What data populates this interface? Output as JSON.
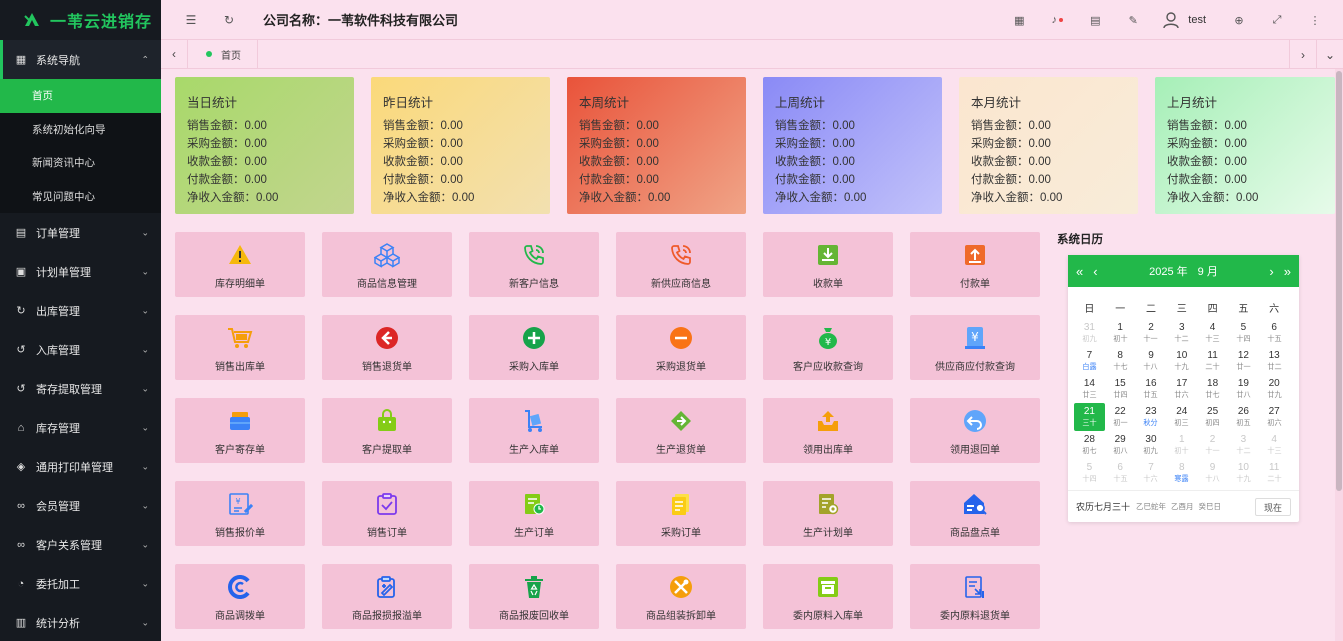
{
  "app": {
    "name": "一苇云进销存"
  },
  "header": {
    "company_label": "公司名称：",
    "company_name": "一苇软件科技有限公司",
    "user": "test"
  },
  "sidebar": {
    "groups": [
      {
        "label": "系统导航",
        "icon": "nav-grid-icon",
        "open": true
      },
      {
        "label": "订单管理",
        "icon": "document-icon"
      },
      {
        "label": "计划单管理",
        "icon": "calendar-icon"
      },
      {
        "label": "出库管理",
        "icon": "outbound-icon"
      },
      {
        "label": "入库管理",
        "icon": "inbound-icon"
      },
      {
        "label": "寄存提取管理",
        "icon": "deposit-icon"
      },
      {
        "label": "库存管理",
        "icon": "home-icon"
      },
      {
        "label": "通用打印单管理",
        "icon": "cube-icon"
      },
      {
        "label": "会员管理",
        "icon": "link-icon"
      },
      {
        "label": "客户关系管理",
        "icon": "link-icon"
      },
      {
        "label": "委托加工",
        "icon": "pie-icon"
      },
      {
        "label": "统计分析",
        "icon": "chart-icon"
      }
    ],
    "sub_items": [
      {
        "label": "首页",
        "active": true
      },
      {
        "label": "系统初始化向导"
      },
      {
        "label": "新闻资讯中心"
      },
      {
        "label": "常见问题中心"
      }
    ]
  },
  "tabs": [
    {
      "label": "首页"
    }
  ],
  "stats": [
    {
      "title": "当日统计",
      "rows": [
        "销售金额：0.00",
        "采购金额：0.00",
        "收款金额：0.00",
        "付款金额：0.00",
        "净收入金额：0.00"
      ]
    },
    {
      "title": "昨日统计",
      "rows": [
        "销售金额：0.00",
        "采购金额：0.00",
        "收款金额：0.00",
        "付款金额：0.00",
        "净收入金额：0.00"
      ]
    },
    {
      "title": "本周统计",
      "rows": [
        "销售金额：0.00",
        "采购金额：0.00",
        "收款金额：0.00",
        "付款金额：0.00",
        "净收入金额：0.00"
      ]
    },
    {
      "title": "上周统计",
      "rows": [
        "销售金额：0.00",
        "采购金额：0.00",
        "收款金额：0.00",
        "付款金额：0.00",
        "净收入金额：0.00"
      ]
    },
    {
      "title": "本月统计",
      "rows": [
        "销售金额：0.00",
        "采购金额：0.00",
        "收款金额：0.00",
        "付款金额：0.00",
        "净收入金额：0.00"
      ]
    },
    {
      "title": "上月统计",
      "rows": [
        "销售金额：0.00",
        "采购金额：0.00",
        "收款金额：0.00",
        "付款金额：0.00",
        "净收入金额：0.00"
      ]
    }
  ],
  "tiles": [
    {
      "label": "库存明细单",
      "icon": "warning-icon"
    },
    {
      "label": "商品信息管理",
      "icon": "cubes-icon"
    },
    {
      "label": "新客户信息",
      "icon": "phone-icon"
    },
    {
      "label": "新供应商信息",
      "icon": "phone-icon"
    },
    {
      "label": "收款单",
      "icon": "download-box-icon"
    },
    {
      "label": "付款单",
      "icon": "upload-box-icon"
    },
    {
      "label": "销售出库单",
      "icon": "cart-icon"
    },
    {
      "label": "销售退货单",
      "icon": "arrow-left-circle-icon"
    },
    {
      "label": "采购入库单",
      "icon": "plus-circle-icon"
    },
    {
      "label": "采购退货单",
      "icon": "minus-circle-icon"
    },
    {
      "label": "客户应收款查询",
      "icon": "money-bag-icon"
    },
    {
      "label": "供应商应付款查询",
      "icon": "yen-bill-icon"
    },
    {
      "label": "客户寄存单",
      "icon": "wallet-icon"
    },
    {
      "label": "客户提取单",
      "icon": "bag-icon"
    },
    {
      "label": "生产入库单",
      "icon": "trolley-icon"
    },
    {
      "label": "生产退货单",
      "icon": "return-tag-icon"
    },
    {
      "label": "领用出库单",
      "icon": "tray-icon"
    },
    {
      "label": "领用退回单",
      "icon": "undo-circle-icon"
    },
    {
      "label": "销售报价单",
      "icon": "quote-doc-icon"
    },
    {
      "label": "销售订单",
      "icon": "clipboard-check-icon"
    },
    {
      "label": "生产订单",
      "icon": "doc-clock-icon"
    },
    {
      "label": "采购订单",
      "icon": "doc-stack-icon"
    },
    {
      "label": "生产计划单",
      "icon": "doc-gear-icon"
    },
    {
      "label": "商品盘点单",
      "icon": "home-search-icon"
    },
    {
      "label": "商品调拨单",
      "icon": "transfer-circle-icon"
    },
    {
      "label": "商品报损报溢单",
      "icon": "clipboard-edit-icon"
    },
    {
      "label": "商品报废回收单",
      "icon": "recycle-bin-icon"
    },
    {
      "label": "商品组装拆卸单",
      "icon": "tools-icon"
    },
    {
      "label": "委内原料入库单",
      "icon": "inbox-box-icon"
    },
    {
      "label": "委内原料退货单",
      "icon": "doc-return-icon"
    }
  ],
  "calendar": {
    "title": "系统日历",
    "year_label": "2025 年",
    "month_label": "9 月",
    "weekdays": [
      "日",
      "一",
      "二",
      "三",
      "四",
      "五",
      "六"
    ],
    "days": [
      {
        "n": "31",
        "l": "初九",
        "dim": true
      },
      {
        "n": "1",
        "l": "初十"
      },
      {
        "n": "2",
        "l": "十一"
      },
      {
        "n": "3",
        "l": "十二"
      },
      {
        "n": "4",
        "l": "十三"
      },
      {
        "n": "5",
        "l": "十四"
      },
      {
        "n": "6",
        "l": "十五"
      },
      {
        "n": "7",
        "l": "白露",
        "blue": true
      },
      {
        "n": "8",
        "l": "十七"
      },
      {
        "n": "9",
        "l": "十八"
      },
      {
        "n": "10",
        "l": "十九"
      },
      {
        "n": "11",
        "l": "二十"
      },
      {
        "n": "12",
        "l": "廿一"
      },
      {
        "n": "13",
        "l": "廿二"
      },
      {
        "n": "14",
        "l": "廿三"
      },
      {
        "n": "15",
        "l": "廿四"
      },
      {
        "n": "16",
        "l": "廿五"
      },
      {
        "n": "17",
        "l": "廿六"
      },
      {
        "n": "18",
        "l": "廿七"
      },
      {
        "n": "19",
        "l": "廿八"
      },
      {
        "n": "20",
        "l": "廿九"
      },
      {
        "n": "21",
        "l": "三十",
        "today": true
      },
      {
        "n": "22",
        "l": "初一"
      },
      {
        "n": "23",
        "l": "秋分",
        "blue": true
      },
      {
        "n": "24",
        "l": "初三"
      },
      {
        "n": "25",
        "l": "初四"
      },
      {
        "n": "26",
        "l": "初五"
      },
      {
        "n": "27",
        "l": "初六"
      },
      {
        "n": "28",
        "l": "初七"
      },
      {
        "n": "29",
        "l": "初八"
      },
      {
        "n": "30",
        "l": "初九"
      },
      {
        "n": "1",
        "l": "初十",
        "dim": true
      },
      {
        "n": "2",
        "l": "十一",
        "dim": true
      },
      {
        "n": "3",
        "l": "十二",
        "dim": true
      },
      {
        "n": "4",
        "l": "十三",
        "dim": true
      },
      {
        "n": "5",
        "l": "十四",
        "dim": true
      },
      {
        "n": "6",
        "l": "十五",
        "dim": true
      },
      {
        "n": "7",
        "l": "十六",
        "dim": true
      },
      {
        "n": "8",
        "l": "寒露",
        "dim": true,
        "blue": true
      },
      {
        "n": "9",
        "l": "十八",
        "dim": true
      },
      {
        "n": "10",
        "l": "十九",
        "dim": true
      },
      {
        "n": "11",
        "l": "二十",
        "dim": true
      }
    ],
    "lunar": "农历七月三十",
    "ganzhi_year": "乙巳蛇年",
    "ganzhi_month": "乙酉月",
    "ganzhi_day": "癸巳日",
    "now_label": "现在"
  },
  "colors": {
    "accent": "#22b84a",
    "sidebar_bg": "#161a20",
    "page_bg": "#fbe1ee",
    "tile_bg": "#f4c2d7"
  }
}
